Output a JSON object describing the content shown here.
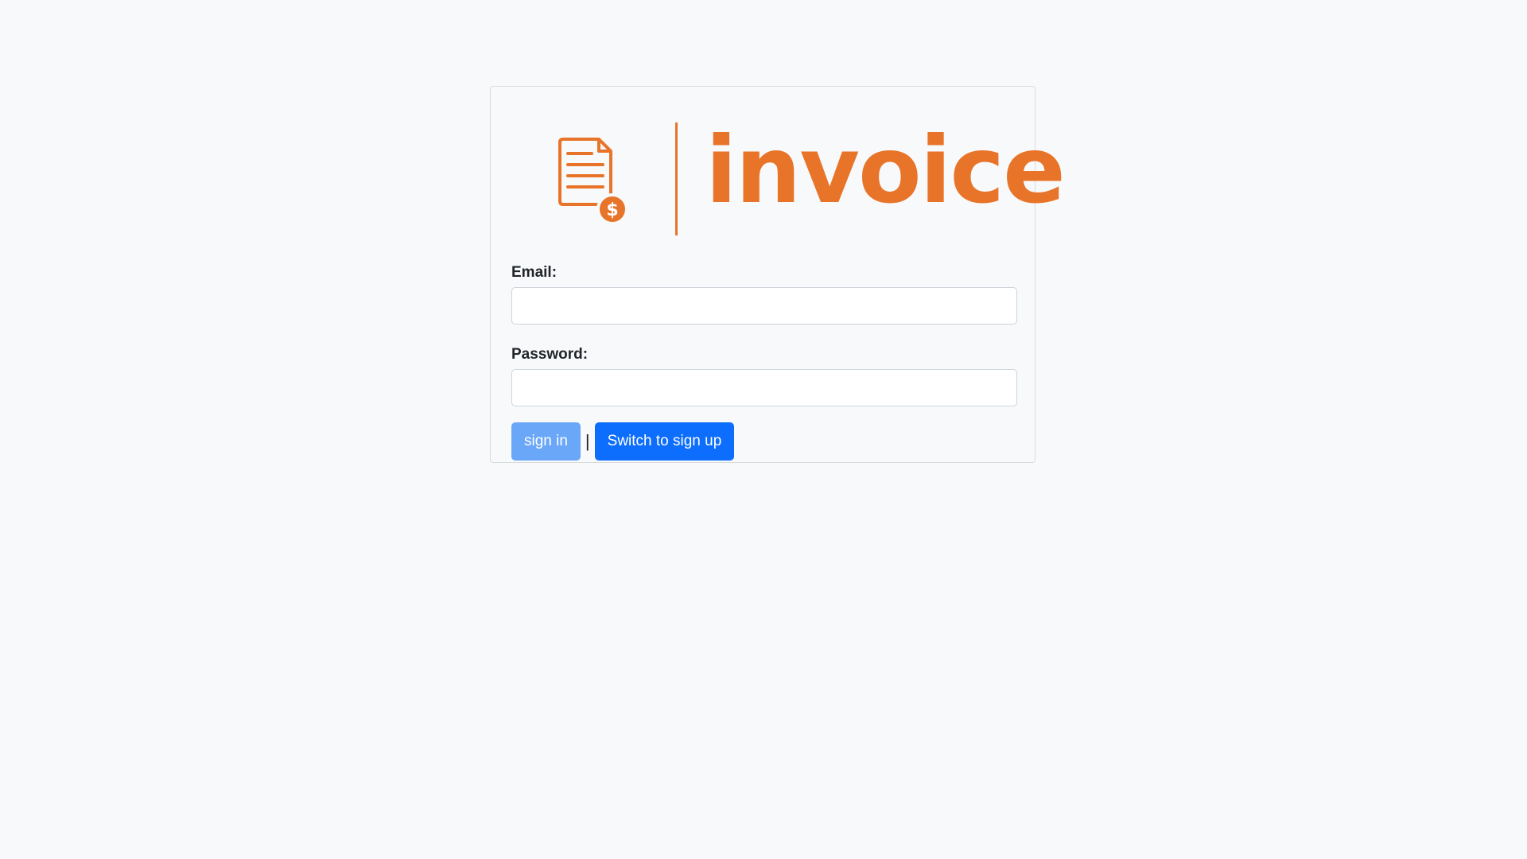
{
  "brand": {
    "name": "invoice",
    "color": "#e8742a",
    "icon": "invoice-dollar-icon"
  },
  "form": {
    "email": {
      "label": "Email:",
      "value": "",
      "placeholder": ""
    },
    "password": {
      "label": "Password:",
      "value": "",
      "placeholder": ""
    },
    "sign_in_label": "sign in",
    "separator": "|",
    "switch_label": "Switch to sign up"
  },
  "colors": {
    "background": "#f8f9fa",
    "primary": "#0d6efd",
    "primary_disabled": "#6aa7f8"
  }
}
